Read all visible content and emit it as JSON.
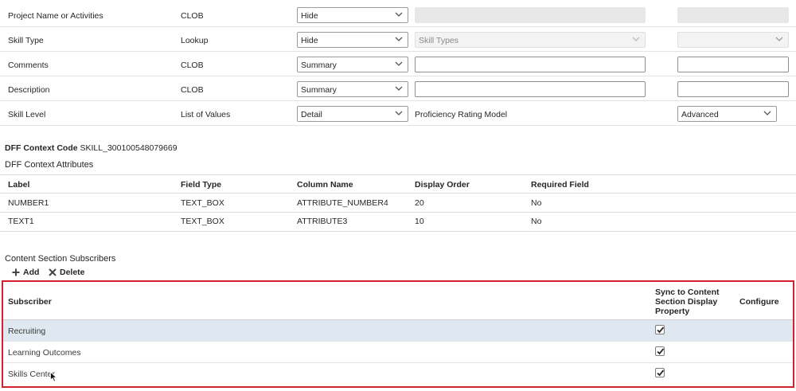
{
  "attribute_rows": [
    {
      "label": "Project Name or Activities",
      "column_type": "CLOB",
      "display": "Hide",
      "extra": ""
    },
    {
      "label": "Skill Type",
      "column_type": "Lookup",
      "display": "Hide",
      "extra": "Skill Types"
    },
    {
      "label": "Comments",
      "column_type": "CLOB",
      "display": "Summary",
      "extra": ""
    },
    {
      "label": "Description",
      "column_type": "CLOB",
      "display": "Summary",
      "extra": ""
    },
    {
      "label": "Skill Level",
      "column_type": "List of Values",
      "display": "Detail",
      "extra": "Proficiency Rating Model",
      "extra_value": "Advanced"
    }
  ],
  "dff": {
    "code_label": "DFF Context Code",
    "code_value": "SKILL_300100548079669",
    "attributes_title": "DFF Context Attributes",
    "headers": [
      "Label",
      "Field Type",
      "Column Name",
      "Display Order",
      "Required Field"
    ],
    "rows": [
      [
        "NUMBER1",
        "TEXT_BOX",
        "ATTRIBUTE_NUMBER4",
        "20",
        "No"
      ],
      [
        "TEXT1",
        "TEXT_BOX",
        "ATTRIBUTE3",
        "10",
        "No"
      ]
    ]
  },
  "subscribers": {
    "title": "Content Section Subscribers",
    "add_label": "Add",
    "delete_label": "Delete",
    "col_subscriber": "Subscriber",
    "col_sync": [
      "Sync to Content",
      "Section Display",
      "Property"
    ],
    "col_configure": "Configure",
    "rows": [
      {
        "name": "Recruiting",
        "sync": true
      },
      {
        "name": "Learning Outcomes",
        "sync": true
      },
      {
        "name": "Skills Center",
        "sync": true
      }
    ]
  },
  "colors": {
    "highlight_frame": "#d3212d",
    "selected_row": "#dfe7f0"
  }
}
